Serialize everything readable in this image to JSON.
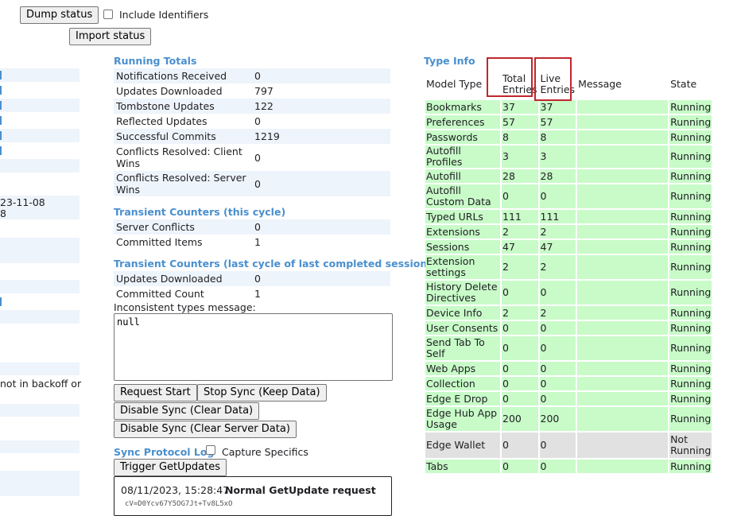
{
  "toolbar": {
    "dump_status": "Dump status",
    "include_identifiers": "Include Identifiers",
    "import_status": "Import status"
  },
  "left_partial": {
    "date_line1": "23-11-08",
    "date_line2": "8",
    "backoff_text": "not in backoff or"
  },
  "running_totals": {
    "title": "Running Totals",
    "rows": [
      {
        "label": "Notifications Received",
        "value": "0"
      },
      {
        "label": "Updates Downloaded",
        "value": "797"
      },
      {
        "label": "Tombstone Updates",
        "value": "122"
      },
      {
        "label": "Reflected Updates",
        "value": "0"
      },
      {
        "label": "Successful Commits",
        "value": "1219"
      },
      {
        "label": "Conflicts Resolved: Client Wins",
        "value": "0"
      },
      {
        "label": "Conflicts Resolved: Server Wins",
        "value": "0"
      }
    ]
  },
  "transient_cycle": {
    "title": "Transient Counters (this cycle)",
    "rows": [
      {
        "label": "Server Conflicts",
        "value": "0"
      },
      {
        "label": "Committed Items",
        "value": "1"
      }
    ]
  },
  "transient_last": {
    "title": "Transient Counters (last cycle of last completed session)",
    "rows": [
      {
        "label": "Updates Downloaded",
        "value": "0"
      },
      {
        "label": "Committed Count",
        "value": "1"
      }
    ]
  },
  "inconsistent": {
    "label": "Inconsistent types message:",
    "value": "null"
  },
  "buttons": {
    "request_start": "Request Start",
    "stop_sync": "Stop Sync (Keep Data)",
    "disable_sync": "Disable Sync (Clear Data)",
    "disable_sync_server": "Disable Sync (Clear Server Data)"
  },
  "protocol_log": {
    "title": "Sync Protocol Log",
    "capture_specifics": "Capture Specifics",
    "trigger": "Trigger GetUpdates",
    "entry_time": "08/11/2023, 15:28:47",
    "entry_title": "Normal GetUpdate request",
    "entry_sub": "cV=D0Ycv67Y5OG7Jt+Tv8L5xO"
  },
  "type_info": {
    "title": "Type Info",
    "headers": [
      "Model Type",
      "Total Entries",
      "Live Entries",
      "Message",
      "State"
    ],
    "rows": [
      {
        "type": "Bookmarks",
        "total": "37",
        "live": "37",
        "message": "",
        "state": "Running"
      },
      {
        "type": "Preferences",
        "total": "57",
        "live": "57",
        "message": "",
        "state": "Running"
      },
      {
        "type": "Passwords",
        "total": "8",
        "live": "8",
        "message": "",
        "state": "Running"
      },
      {
        "type": "Autofill Profiles",
        "total": "3",
        "live": "3",
        "message": "",
        "state": "Running"
      },
      {
        "type": "Autofill",
        "total": "28",
        "live": "28",
        "message": "",
        "state": "Running"
      },
      {
        "type": "Autofill Custom Data",
        "total": "0",
        "live": "0",
        "message": "",
        "state": "Running"
      },
      {
        "type": "Typed URLs",
        "total": "111",
        "live": "111",
        "message": "",
        "state": "Running"
      },
      {
        "type": "Extensions",
        "total": "2",
        "live": "2",
        "message": "",
        "state": "Running"
      },
      {
        "type": "Sessions",
        "total": "47",
        "live": "47",
        "message": "",
        "state": "Running"
      },
      {
        "type": "Extension settings",
        "total": "2",
        "live": "2",
        "message": "",
        "state": "Running"
      },
      {
        "type": "History Delete Directives",
        "total": "0",
        "live": "0",
        "message": "",
        "state": "Running"
      },
      {
        "type": "Device Info",
        "total": "2",
        "live": "2",
        "message": "",
        "state": "Running"
      },
      {
        "type": "User Consents",
        "total": "0",
        "live": "0",
        "message": "",
        "state": "Running"
      },
      {
        "type": "Send Tab To Self",
        "total": "0",
        "live": "0",
        "message": "",
        "state": "Running"
      },
      {
        "type": "Web Apps",
        "total": "0",
        "live": "0",
        "message": "",
        "state": "Running"
      },
      {
        "type": "Collection",
        "total": "0",
        "live": "0",
        "message": "",
        "state": "Running"
      },
      {
        "type": "Edge E Drop",
        "total": "0",
        "live": "0",
        "message": "",
        "state": "Running"
      },
      {
        "type": "Edge Hub App Usage",
        "total": "200",
        "live": "200",
        "message": "",
        "state": "Running"
      },
      {
        "type": "Edge Wallet",
        "total": "0",
        "live": "0",
        "message": "",
        "state": "Not Running"
      },
      {
        "type": "Tabs",
        "total": "0",
        "live": "0",
        "message": "",
        "state": "Running"
      }
    ]
  },
  "colors": {
    "section_title": "#4a8fce",
    "row_running": "#c8fbc8",
    "row_stopped": "#e1e1e1",
    "stripe": "#eef4fb",
    "highlight_box": "#c0272d"
  }
}
